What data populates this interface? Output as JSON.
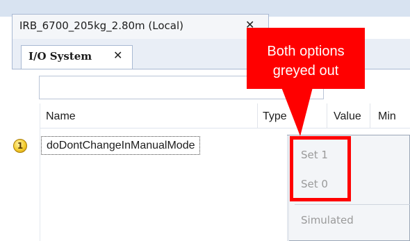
{
  "document_tab": {
    "label": "IRB_6700_205kg_2.80m (Local)",
    "close_label": "✕"
  },
  "io_tab": {
    "label": "I/O System",
    "close_label": "✕"
  },
  "filter": {
    "value": "",
    "placeholder": ""
  },
  "table": {
    "columns": [
      "Name",
      "Type",
      "Value",
      "Min"
    ],
    "rows": [
      {
        "status_icon": "1",
        "name": "doDontChangeInManualMode"
      }
    ]
  },
  "context_menu": {
    "items": [
      {
        "label": "Set 1",
        "enabled": false
      },
      {
        "label": "Set 0",
        "enabled": false
      },
      {
        "label": "Simulated",
        "enabled": false
      }
    ]
  },
  "annotation": {
    "callout_text_line1": "Both options",
    "callout_text_line2": "greyed out",
    "color": "#ff0000"
  },
  "colors": {
    "tab_border": "#a9b9d3",
    "panel_background": "#e9eef6",
    "disabled_text": "#9a9a9a"
  }
}
